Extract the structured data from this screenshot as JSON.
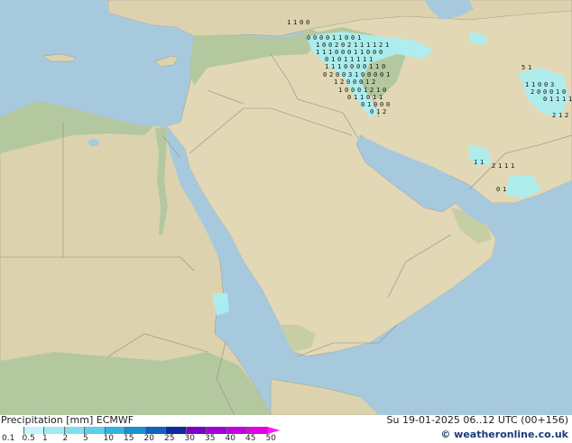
{
  "title": "Precipitation [mm]  ECMWF",
  "datetime": "Su 19-01-2025 06..12 UTC (00+156)",
  "credit": "© weatheronline.co.uk",
  "scale": {
    "labels": [
      "0.1",
      "0.5",
      "1",
      "2",
      "5",
      "10",
      "15",
      "20",
      "25",
      "30",
      "35",
      "40",
      "45",
      "50"
    ],
    "colors": [
      "#ffffff",
      "#c4f4f8",
      "#9eeaf2",
      "#7ee0ee",
      "#5cd0e8",
      "#30b4e0",
      "#1c90d0",
      "#1460c0",
      "#0c2c9c",
      "#7c00c8",
      "#a000d8",
      "#c400e0",
      "#e000e8",
      "#f020f0"
    ]
  },
  "colors": {
    "sea": "#a7c9dd",
    "land_green": "#b4c8a0",
    "land_desert": "#e2d8b6",
    "precip": "#aaf0f4"
  },
  "map_values": [
    "1",
    "1",
    "0",
    "0",
    "0",
    "0",
    "0",
    "0",
    "1",
    "1",
    "0",
    "0",
    "1",
    "1",
    "0",
    "0",
    "2",
    "0",
    "2",
    "1",
    "1",
    "1",
    "1",
    "2",
    "1",
    "1",
    "1",
    "1",
    "0",
    "0",
    "0",
    "1",
    "1",
    "0",
    "0",
    "0",
    "0",
    "1",
    "0",
    "1",
    "1",
    "1",
    "1",
    "1",
    "1",
    "1",
    "1",
    "0",
    "0",
    "0",
    "0",
    "1",
    "1",
    "0",
    "0",
    "2",
    "0",
    "0",
    "3",
    "1",
    "0",
    "0",
    "0",
    "0",
    "1",
    "1",
    "2",
    "0",
    "0",
    "0",
    "1",
    "2",
    "1",
    "0",
    "0",
    "0",
    "1",
    "2",
    "1",
    "0",
    "0",
    "1",
    "1",
    "0",
    "1",
    "1",
    "0",
    "1",
    "0",
    "0",
    "0",
    "0",
    "1",
    "2",
    "5",
    "1",
    "1",
    "1",
    "0",
    "0",
    "3",
    "2",
    "0",
    "0",
    "0",
    "1",
    "0",
    "0",
    "1",
    "1",
    "1",
    "1",
    "2",
    "1",
    "2",
    "1",
    "1",
    "2",
    "1",
    "1",
    "1",
    "0",
    "1"
  ]
}
